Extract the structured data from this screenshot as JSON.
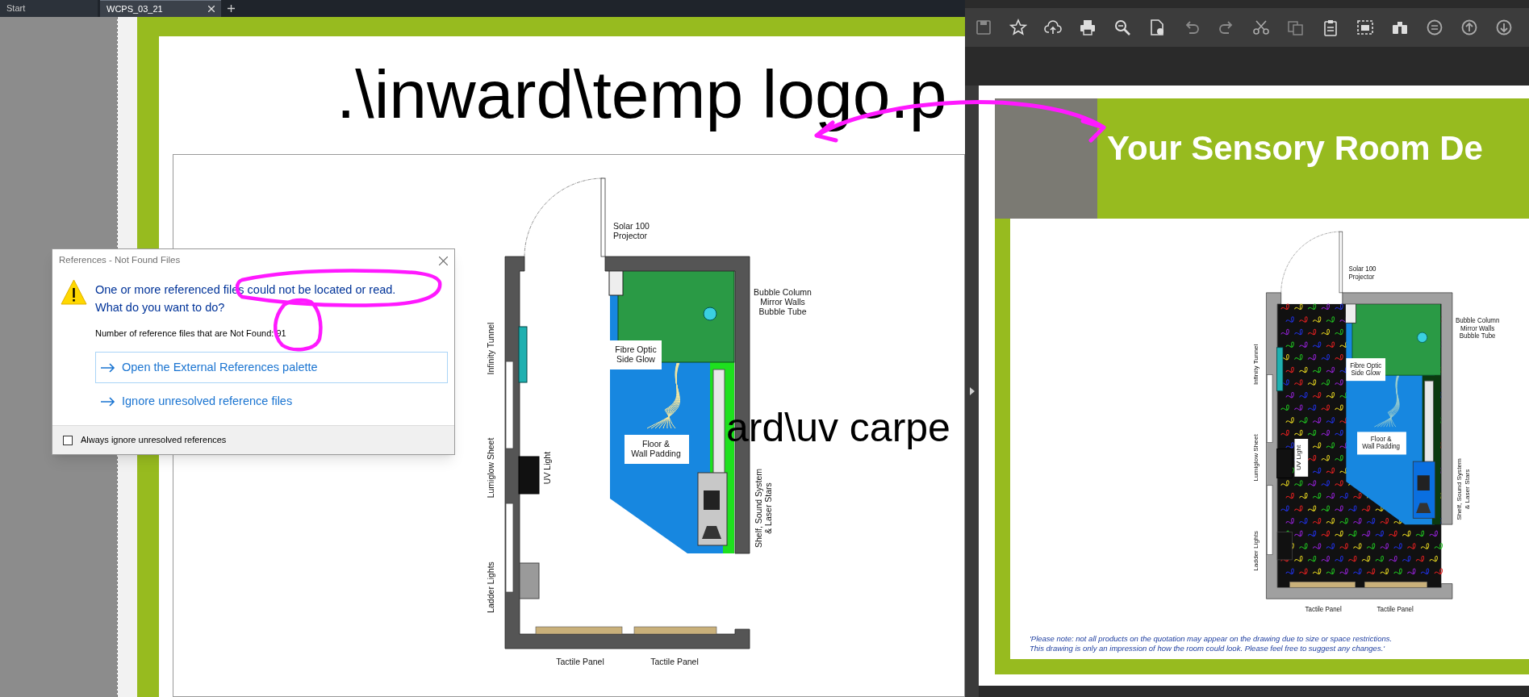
{
  "left_app": {
    "tabs": [
      {
        "label": "Start",
        "selected": false
      },
      {
        "label": "WCPS_03_21",
        "selected": true
      }
    ],
    "drawing": {
      "logo_reference": ".\\inward\\temp logo.p",
      "carpet_reference": "ard\\uv carpe",
      "floor_plan": {
        "carpet": false,
        "labels": [
          {
            "lines": [
              "Solar 100",
              "Projector"
            ]
          },
          {
            "lines": [
              "Bubble Column",
              "Mirror Walls",
              "Bubble Tube"
            ]
          },
          {
            "lines": [
              "Infinity Tunnel"
            ]
          },
          {
            "lines": [
              "Fibre Optic",
              "Side Glow"
            ]
          },
          {
            "lines": [
              "Lumiglow Sheet"
            ]
          },
          {
            "lines": [
              "UV Light"
            ]
          },
          {
            "lines": [
              "Floor &",
              "Wall Padding"
            ]
          },
          {
            "lines": [
              "Ladder Lights"
            ]
          },
          {
            "lines": [
              "Shelf, Sound System",
              "& Laser Stars"
            ]
          },
          {
            "lines": [
              "Tactile Panel"
            ]
          },
          {
            "lines": [
              "Tactile Panel"
            ]
          }
        ]
      }
    }
  },
  "dialog": {
    "title": "References - Not Found Files",
    "message_lines": [
      "One or more referenced files could not be located or read.",
      "What do you want to do?"
    ],
    "count_line": "Number of reference files that are Not Found: 91",
    "options": [
      {
        "label": "Open the External References palette",
        "selected": true
      },
      {
        "label": "Ignore unresolved reference files",
        "selected": false
      }
    ],
    "checkbox": {
      "label": "Always ignore unresolved references",
      "checked": false
    }
  },
  "viewer": {
    "page": {
      "header_title": "Your Sensory Room De",
      "floor_plan": {
        "carpet": true,
        "labels": [
          {
            "lines": [
              "Solar 100",
              "Projector"
            ]
          },
          {
            "lines": [
              "Bubble Column",
              "Mirror Walls",
              "Bubble Tube"
            ]
          },
          {
            "lines": [
              "Infinity Tunnel"
            ]
          },
          {
            "lines": [
              "Fibre Optic",
              "Side Glow"
            ]
          },
          {
            "lines": [
              "Lumiglow Sheet"
            ]
          },
          {
            "lines": [
              "UV Light"
            ]
          },
          {
            "lines": [
              "Floor &",
              "Wall Padding"
            ]
          },
          {
            "lines": [
              "Ladder Lights"
            ]
          },
          {
            "lines": [
              "Shelf, Sound System",
              "& Laser Stars"
            ]
          },
          {
            "lines": [
              "Tactile Panel"
            ]
          },
          {
            "lines": [
              "Tactile Panel"
            ]
          }
        ]
      },
      "note_lines": [
        "'Please note: not all products on the quotation may appear on the drawing due to size or space restrictions.",
        "This drawing is only an impression of how the room could look. Please feel free to suggest any changes.'"
      ]
    }
  }
}
